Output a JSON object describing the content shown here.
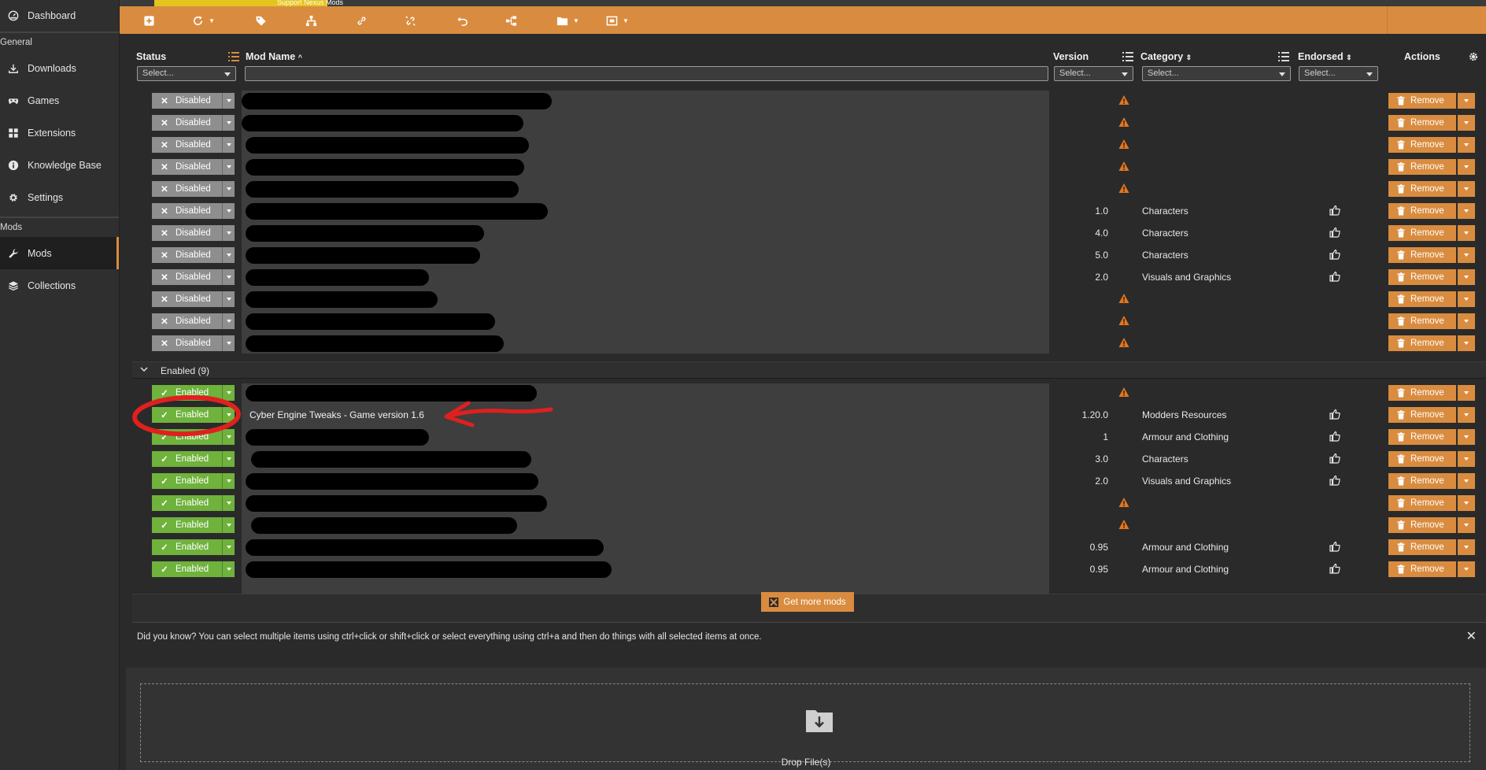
{
  "banner": {
    "text": "Support Nexus Mods"
  },
  "sidebar": {
    "items_top": [
      {
        "label": "Dashboard",
        "icon": "dashboard-icon"
      }
    ],
    "section_general": "General",
    "items_general": [
      {
        "label": "Downloads",
        "icon": "download-icon"
      },
      {
        "label": "Games",
        "icon": "gamepad-icon"
      },
      {
        "label": "Extensions",
        "icon": "extensions-icon"
      },
      {
        "label": "Knowledge Base",
        "icon": "info-icon"
      },
      {
        "label": "Settings",
        "icon": "gear-icon"
      }
    ],
    "section_mods": "Mods",
    "items_mods": [
      {
        "label": "Mods",
        "icon": "wrench-icon",
        "active": true
      },
      {
        "label": "Collections",
        "icon": "layers-icon"
      }
    ]
  },
  "table": {
    "headers": {
      "status": "Status",
      "mod_name": "Mod Name",
      "version": "Version",
      "category": "Category",
      "endorsed": "Endorsed",
      "actions": "Actions"
    },
    "filters": {
      "status_placeholder": "Select...",
      "version_placeholder": "Select...",
      "category_placeholder": "Select...",
      "endorsed_placeholder": "Select..."
    },
    "disabled_rows": [
      {
        "status": "Disabled",
        "version": "",
        "warning": true,
        "category": "",
        "endorse": false
      },
      {
        "status": "Disabled",
        "version": "",
        "warning": true,
        "category": "",
        "endorse": false
      },
      {
        "status": "Disabled",
        "version": "",
        "warning": true,
        "category": "",
        "endorse": false
      },
      {
        "status": "Disabled",
        "version": "",
        "warning": true,
        "category": "",
        "endorse": false
      },
      {
        "status": "Disabled",
        "version": "",
        "warning": true,
        "category": "",
        "endorse": false
      },
      {
        "status": "Disabled",
        "version": "1.0",
        "warning": false,
        "category": "Characters",
        "endorse": true
      },
      {
        "status": "Disabled",
        "version": "4.0",
        "warning": false,
        "category": "Characters",
        "endorse": true
      },
      {
        "status": "Disabled",
        "version": "5.0",
        "warning": false,
        "category": "Characters",
        "endorse": true
      },
      {
        "status": "Disabled",
        "version": "2.0",
        "warning": false,
        "category": "Visuals and Graphics",
        "endorse": true
      },
      {
        "status": "Disabled",
        "version": "",
        "warning": true,
        "category": "",
        "endorse": false
      },
      {
        "status": "Disabled",
        "version": "",
        "warning": true,
        "category": "",
        "endorse": false
      },
      {
        "status": "Disabled",
        "version": "",
        "warning": true,
        "category": "",
        "endorse": false
      }
    ],
    "enabled_group_label": "Enabled (9)",
    "enabled_rows": [
      {
        "status": "Enabled",
        "name": "",
        "version": "",
        "warning": true,
        "category": "",
        "endorse": false
      },
      {
        "status": "Enabled",
        "name": "Cyber Engine Tweaks - Game version 1.6",
        "version": "1.20.0",
        "warning": false,
        "category": "Modders Resources",
        "endorse": true
      },
      {
        "status": "Enabled",
        "name": "",
        "version": "1",
        "warning": false,
        "category": "Armour and Clothing",
        "endorse": true
      },
      {
        "status": "Enabled",
        "name": "",
        "version": "3.0",
        "warning": false,
        "category": "Characters",
        "endorse": true
      },
      {
        "status": "Enabled",
        "name": "",
        "version": "2.0",
        "warning": false,
        "category": "Visuals and Graphics",
        "endorse": true
      },
      {
        "status": "Enabled",
        "name": "",
        "version": "",
        "warning": true,
        "category": "",
        "endorse": false
      },
      {
        "status": "Enabled",
        "name": "",
        "version": "",
        "warning": true,
        "category": "",
        "endorse": false
      },
      {
        "status": "Enabled",
        "name": "",
        "version": "0.95",
        "warning": false,
        "category": "Armour and Clothing",
        "endorse": true
      },
      {
        "status": "Enabled",
        "name": "",
        "version": "0.95",
        "warning": false,
        "category": "Armour and Clothing",
        "endorse": true
      }
    ],
    "remove_label": "Remove"
  },
  "get_more_label": "Get more mods",
  "tip_text": "Did you know? You can select multiple items using ctrl+click or shift+click or select everything using ctrl+a and then do things with all selected items at once.",
  "drop_label": "Drop File(s)",
  "colors": {
    "accent": "#d98c3f",
    "enabled": "#6fb23c",
    "disabled": "#8e8e8e",
    "warning": "#e8751a",
    "annotation": "#e0201e"
  }
}
